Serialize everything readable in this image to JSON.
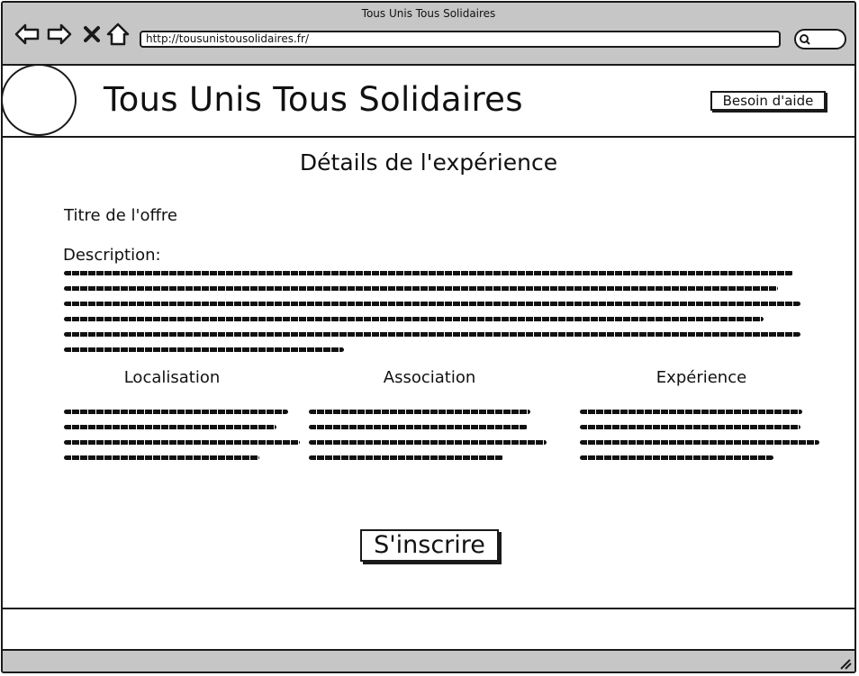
{
  "browser": {
    "window_title": "Tous Unis Tous Solidaires",
    "url": "http://tousunistousolidaires.fr/",
    "nav_icons": [
      "back-arrow-icon",
      "forward-arrow-icon",
      "close-x-icon",
      "home-icon"
    ],
    "search_icon": "search-icon"
  },
  "header": {
    "site_title": "Tous Unis Tous Solidaires",
    "help_label": "Besoin d'aide"
  },
  "main": {
    "page_heading": "Détails de l'expérience",
    "offer_title": "Titre de l'offre",
    "description_label": "Description:",
    "columns": [
      {
        "heading": "Localisation"
      },
      {
        "heading": "Association"
      },
      {
        "heading": "Expérience"
      }
    ],
    "signup_label": "S'inscrire"
  },
  "colors": {
    "chrome": "#c6c6c6",
    "ink": "#1a1a1a",
    "background": "#ffffff"
  }
}
